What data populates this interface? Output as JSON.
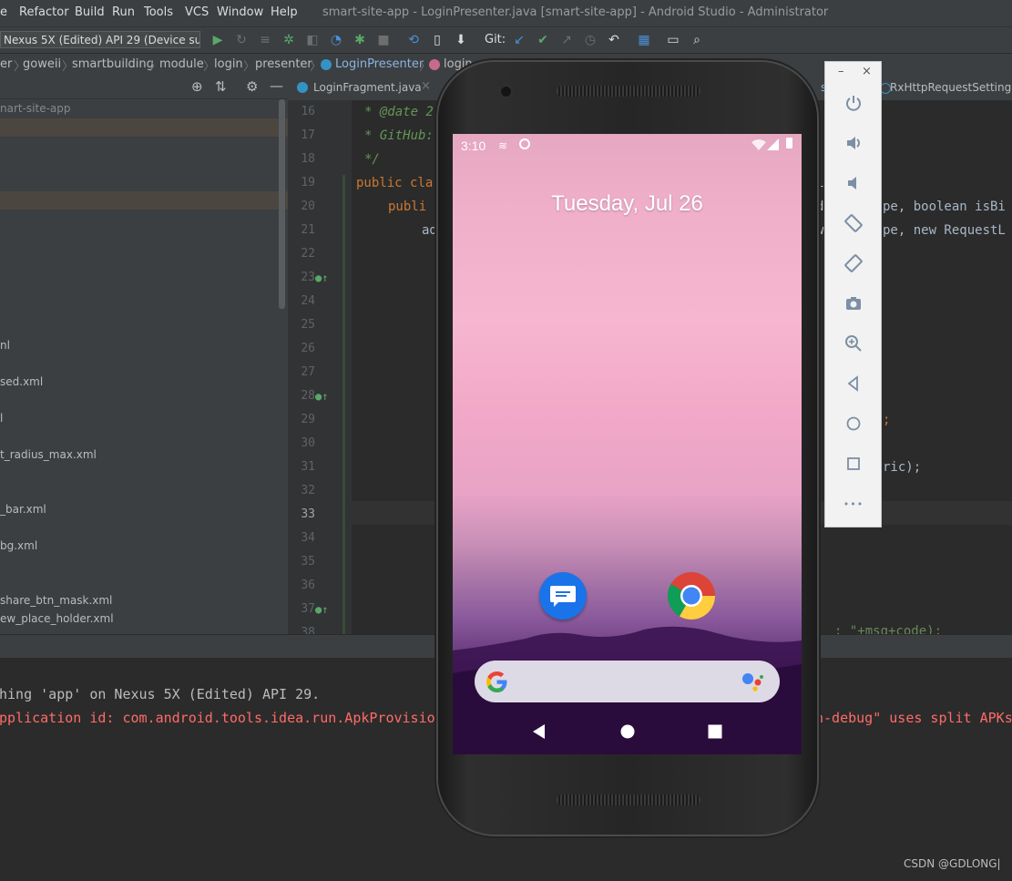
{
  "menu": {
    "items": [
      "e",
      "Refactor",
      "Build",
      "Run",
      "Tools",
      "VCS",
      "Window",
      "Help"
    ],
    "window_title": "smart-site-app - LoginPresenter.java [smart-site-app] - Android Studio - Administrator"
  },
  "toolbar": {
    "device": "Nexus 5X (Edited) API 29 (Device sur...",
    "git_label": "Git:"
  },
  "breadcrumb": [
    "er",
    "goweii",
    "smartbuilding",
    "module",
    "login",
    "presenter",
    "LoginPresenter",
    "login"
  ],
  "project": {
    "root": "nart-site-app",
    "files": [
      "nl",
      "sed.xml",
      "l",
      "t_radius_max.xml",
      "_bar.xml",
      "bg.xml",
      "share_btn_mask.xml",
      "ew_place_holder.xml"
    ]
  },
  "editor_tabs": {
    "left": "LoginFragment.java",
    "right": "RxHttpRequestSetting.ja",
    "partial": "st"
  },
  "editor": {
    "line_numbers": [
      "16",
      "17",
      "18",
      "19",
      "20",
      "21",
      "22",
      "23",
      "24",
      "25",
      "26",
      "27",
      "28",
      "29",
      "30",
      "31",
      "32",
      "33",
      "34",
      "35",
      "36",
      "37",
      "38"
    ],
    "current_line": "33",
    "lines": {
      "l16": "* @date 2",
      "l17": "* GitHub:",
      "l18": "*/",
      "l19": "public cla",
      "l20": "publi",
      "l21": "ad",
      "r19": "i",
      "r20a": "d",
      "r20b": "pe, boolean isBi",
      "r21a": "w",
      "r21b": "pe, new RequestL",
      "r29": ";",
      "r31": "ric);",
      "r37": ": \"+msg+code);"
    }
  },
  "console": {
    "line1": "hing 'app' on Nexus 5X (Edited) API 29.",
    "line2a": "pplication id: com.android.tools.idea.run.ApkProvisio",
    "line2b": "n-debug\" uses split APKs,"
  },
  "phone": {
    "time": "3:10",
    "date": "Tuesday, Jul 26",
    "apps": [
      "messages-icon",
      "chrome-icon"
    ]
  },
  "emulator_panel": {
    "minimize": "–",
    "close": "×",
    "more": "•••"
  },
  "watermark": "CSDN @GDLONG|",
  "colors": {
    "keyword": "#cc7832",
    "comment": "#629755",
    "console_red": "#ff6b68",
    "accent_blue": "#4a90d9"
  }
}
